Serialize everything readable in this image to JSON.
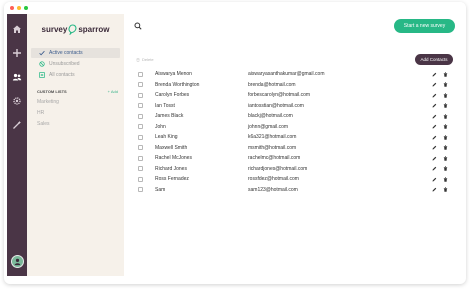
{
  "app": {
    "logo_left": "survey",
    "logo_right": "sparrow"
  },
  "sidebar": {
    "nav": [
      {
        "label": "Active contacts",
        "icon": "user-check-icon",
        "active": true
      },
      {
        "label": "Unsubscribed",
        "icon": "block-icon",
        "active": false
      },
      {
        "label": "All contacts",
        "icon": "list-icon",
        "active": false
      }
    ],
    "custom_lists_label": "CUSTOM LISTS",
    "add_label": "+ Add",
    "lists": [
      "Marketing",
      "HR",
      "Sales"
    ]
  },
  "toolbar": {
    "new_survey_label": "Start a new survey",
    "delete_label": "Delete",
    "add_contacts_label": "Add Contacts"
  },
  "contacts": [
    {
      "name": "Aiswarya Menon",
      "email": "aiswaryasanthakumar@gmail.com"
    },
    {
      "name": "Brenda Worthington",
      "email": "brenda@hotmail.com"
    },
    {
      "name": "Carolyn Forbes",
      "email": "forbescarolyn@hotmail.com"
    },
    {
      "name": "Ian Tosst",
      "email": "iantosstian@hotmail.com"
    },
    {
      "name": "James Black",
      "email": "blackj@hotmail.com"
    },
    {
      "name": "John",
      "email": "johnn@gmail.com"
    },
    {
      "name": "Leah King",
      "email": "k6a321@hotmail.com"
    },
    {
      "name": "Maxwell Smith",
      "email": "msmith@hotmail.com"
    },
    {
      "name": "Rachel McJones",
      "email": "rachelmc@hotmail.com"
    },
    {
      "name": "Richard Jones",
      "email": "richardjones@hotmail.com"
    },
    {
      "name": "Ross Fernadez",
      "email": "rossfdez@hotmail.com"
    },
    {
      "name": "Sam",
      "email": "sam123@hotmail.com"
    }
  ],
  "colors": {
    "rail": "#4a3546",
    "sidebar": "#f6f1ea",
    "primary_button": "#27b886",
    "dark_button": "#4a3546",
    "window_dots": [
      "#ff5f57",
      "#febc2e",
      "#28c840"
    ]
  }
}
